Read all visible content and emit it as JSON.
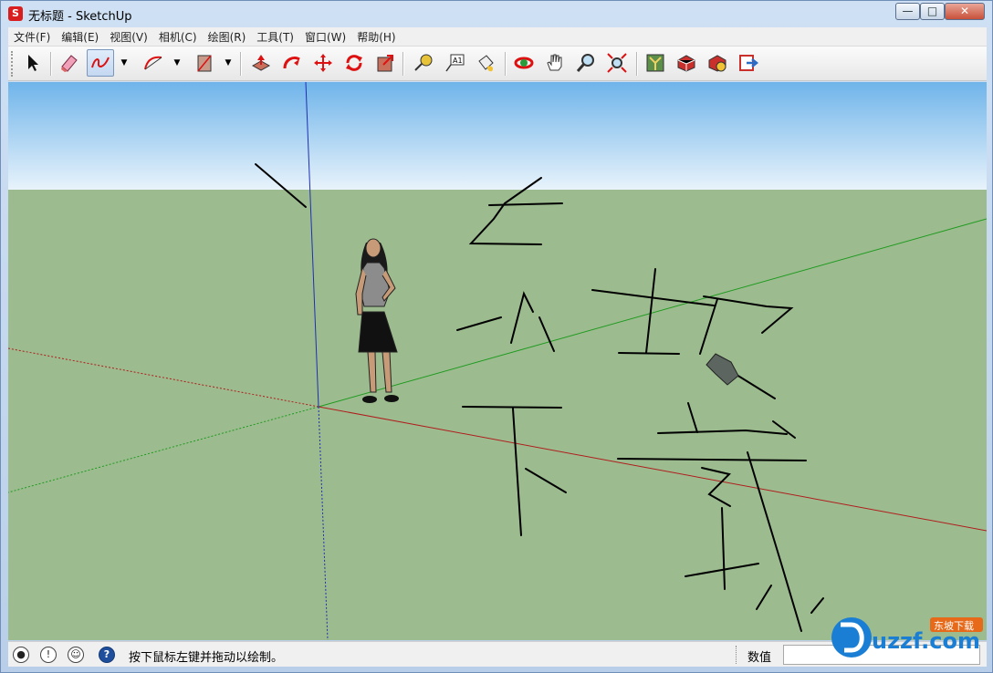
{
  "window": {
    "app_icon_glyph": "S",
    "title": "无标题 - SketchUp",
    "controls": {
      "minimize": "—",
      "maximize": "□",
      "close": "✕"
    }
  },
  "menu": [
    "文件(F)",
    "编辑(E)",
    "视图(V)",
    "相机(C)",
    "绘图(R)",
    "工具(T)",
    "窗口(W)",
    "帮助(H)"
  ],
  "toolbar": {
    "tools": [
      "select-icon",
      "eraser-icon",
      "freehand-icon",
      "arc-icon",
      "rectangle-icon",
      "push-pull-icon",
      "follow-me-icon",
      "move-icon",
      "rotate-icon",
      "scale-icon",
      "tape-measure-icon",
      "text-icon",
      "paint-bucket-icon",
      "orbit-icon",
      "pan-icon",
      "zoom-icon",
      "zoom-extents-icon",
      "components-icon",
      "3d-warehouse-icon",
      "share-component-icon",
      "send-to-layout-icon"
    ],
    "active_tool": "freehand-icon",
    "dropdown_glyph": "▼",
    "text_tool_label": "A1"
  },
  "viewport": {
    "sky_top_color": "#6fb4ea",
    "sky_bottom_color": "#e8f3fb",
    "ground_color": "#9cbc8f",
    "axis_colors": {
      "red": "#b01d1d",
      "green": "#1f9a1f",
      "blue": "#1f2fb2"
    }
  },
  "status": {
    "icons": [
      "geo-location-icon",
      "credits-icon",
      "user-icon",
      "help-icon"
    ],
    "help_glyph": "?",
    "credits_glyph": "!",
    "message": "按下鼠标左键并拖动以绘制。",
    "measurement_label": "数值",
    "measurement_value": ""
  },
  "watermark": {
    "logo_text": "uzzf.com",
    "tagline": "东坡下载"
  }
}
